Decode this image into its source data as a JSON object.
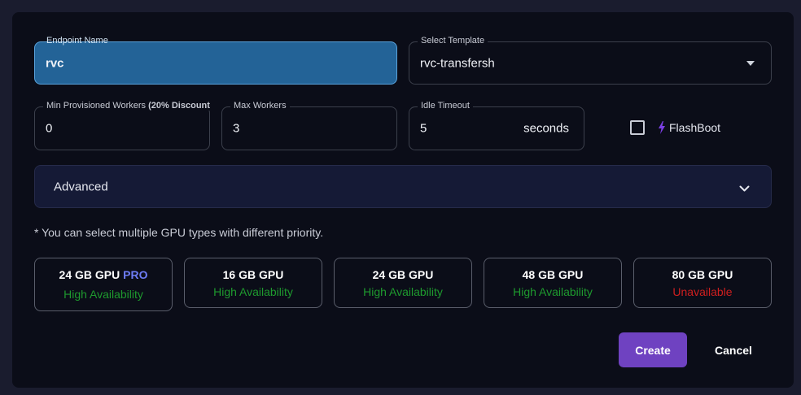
{
  "form": {
    "endpoint_name": {
      "label": "Endpoint Name",
      "value": "rvc"
    },
    "template": {
      "label": "Select Template",
      "value": "rvc-transfersh"
    },
    "min_workers": {
      "label": "Min Provisioned Workers",
      "label_bold": "(20% Discount",
      "value": "0"
    },
    "max_workers": {
      "label": "Max Workers",
      "value": "3"
    },
    "idle_timeout": {
      "label": "Idle Timeout",
      "value": "5",
      "suffix": "seconds"
    },
    "flashboot": {
      "label": "FlashBoot",
      "checked": false,
      "icon": "bolt-icon",
      "icon_color": "#7b3fe4"
    }
  },
  "advanced": {
    "label": "Advanced",
    "icon": "chevron-down-icon"
  },
  "gpu_note": "* You can select multiple GPU types with different priority.",
  "gpus": [
    {
      "name": "24 GB GPU",
      "badge": "PRO",
      "availability": "High Availability",
      "status_color": "#1e9a2e"
    },
    {
      "name": "16 GB GPU",
      "availability": "High Availability",
      "status_color": "#1e9a2e"
    },
    {
      "name": "24 GB GPU",
      "availability": "High Availability",
      "status_color": "#1e9a2e"
    },
    {
      "name": "48 GB GPU",
      "availability": "High Availability",
      "status_color": "#1e9a2e"
    },
    {
      "name": "80 GB GPU",
      "availability": "Unavailable",
      "status_color": "#d01f1f"
    }
  ],
  "actions": {
    "create": "Create",
    "cancel": "Cancel"
  },
  "colors": {
    "accent": "#6f42c1",
    "pro_badge": "#6d7cf5",
    "active_field": "#236397"
  }
}
